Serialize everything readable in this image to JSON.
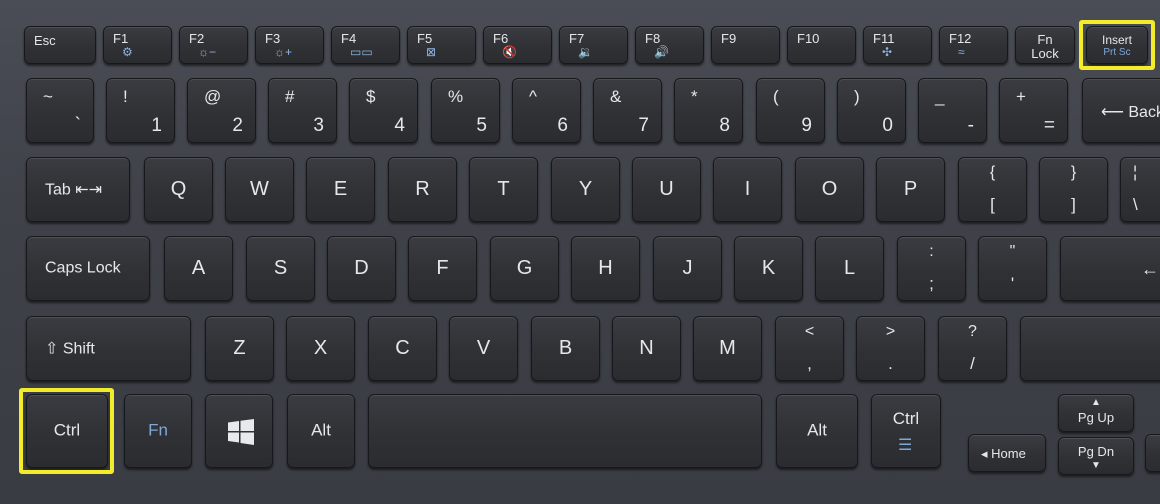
{
  "row_fn": [
    {
      "name": "esc",
      "label": "Esc",
      "icon": ""
    },
    {
      "name": "f1",
      "label": "F1",
      "icon": "⚙"
    },
    {
      "name": "f2",
      "label": "F2",
      "icon": "☼−"
    },
    {
      "name": "f3",
      "label": "F3",
      "icon": "☼+"
    },
    {
      "name": "f4",
      "label": "F4",
      "icon": "▭▭"
    },
    {
      "name": "f5",
      "label": "F5",
      "icon": "⊠"
    },
    {
      "name": "f6",
      "label": "F6",
      "icon": "🔇"
    },
    {
      "name": "f7",
      "label": "F7",
      "icon": "🔉"
    },
    {
      "name": "f8",
      "label": "F8",
      "icon": "🔊"
    },
    {
      "name": "f9",
      "label": "F9",
      "icon": ""
    },
    {
      "name": "f10",
      "label": "F10",
      "icon": ""
    },
    {
      "name": "f11",
      "label": "F11",
      "icon": "✣"
    },
    {
      "name": "f12",
      "label": "F12",
      "icon": "≈"
    }
  ],
  "fn_lock": {
    "line1": "Fn",
    "line2": "Lock"
  },
  "insert": {
    "line1": "Insert",
    "line2": "Prt Sc"
  },
  "row_num": [
    {
      "top": "~",
      "bot": "`"
    },
    {
      "top": "!",
      "bot": "1"
    },
    {
      "top": "@",
      "bot": "2"
    },
    {
      "top": "#",
      "bot": "3"
    },
    {
      "top": "$",
      "bot": "4"
    },
    {
      "top": "%",
      "bot": "5"
    },
    {
      "top": "^",
      "bot": "6"
    },
    {
      "top": "&",
      "bot": "7"
    },
    {
      "top": "*",
      "bot": "8"
    },
    {
      "top": "(",
      "bot": "9"
    },
    {
      "top": ")",
      "bot": "0"
    },
    {
      "top": "_",
      "bot": "-"
    },
    {
      "top": "+",
      "bot": "="
    }
  ],
  "backspace": "⟵ Back",
  "tab": "Tab ⇤⇥",
  "row_q": [
    "Q",
    "W",
    "E",
    "R",
    "T",
    "Y",
    "U",
    "I",
    "O",
    "P"
  ],
  "brackets": [
    {
      "top": "{",
      "bot": "["
    },
    {
      "top": "}",
      "bot": "]"
    },
    {
      "top": "¦",
      "bot": "\\"
    }
  ],
  "capslock": "Caps Lock",
  "row_a": [
    "A",
    "S",
    "D",
    "F",
    "G",
    "H",
    "J",
    "K",
    "L"
  ],
  "semi": [
    {
      "top": ":",
      "bot": ";"
    },
    {
      "top": "\"",
      "bot": "'"
    }
  ],
  "enter_arrow": "←",
  "shift": "⇧ Shift",
  "row_z": [
    "Z",
    "X",
    "C",
    "V",
    "B",
    "N",
    "M"
  ],
  "punct": [
    {
      "top": "<",
      "bot": ","
    },
    {
      "top": ">",
      "bot": "."
    },
    {
      "top": "?",
      "bot": "/"
    }
  ],
  "bottom": {
    "ctrl_left": "Ctrl",
    "fn": "Fn",
    "win": "windows-logo",
    "alt_left": "Alt",
    "alt_right": "Alt",
    "ctrl_right": "Ctrl",
    "home": "◂ Home",
    "pgup": "Pg Up",
    "pgdn": "Pg Dn"
  },
  "colors": {
    "highlight": "#f2ec2b",
    "fn_blue": "#7fa8da"
  }
}
